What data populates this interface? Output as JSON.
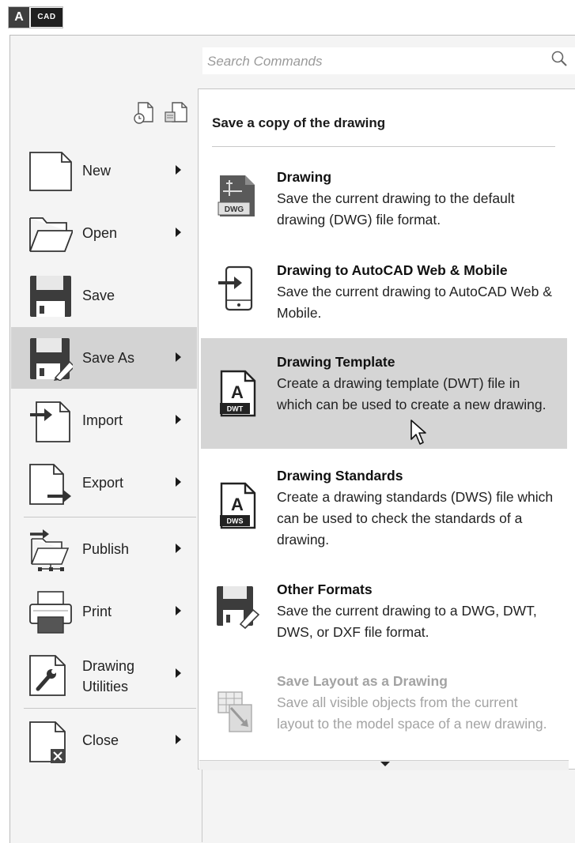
{
  "app_button": {
    "letter": "A",
    "tag": "CAD"
  },
  "search": {
    "placeholder": "Search Commands"
  },
  "left_menu": {
    "items": [
      {
        "label": "New",
        "has_submenu": true
      },
      {
        "label": "Open",
        "has_submenu": true
      },
      {
        "label": "Save",
        "has_submenu": false
      },
      {
        "label": "Save As",
        "has_submenu": true,
        "active": true
      },
      {
        "label": "Import",
        "has_submenu": true
      },
      {
        "label": "Export",
        "has_submenu": true
      },
      {
        "label": "Publish",
        "has_submenu": true
      },
      {
        "label": "Print",
        "has_submenu": true
      },
      {
        "label": "Drawing\nUtilities",
        "has_submenu": true
      },
      {
        "label": "Close",
        "has_submenu": true
      }
    ]
  },
  "submenu": {
    "title": "Save a copy of the drawing",
    "items": [
      {
        "title": "Drawing",
        "description": "Save the current drawing to the default drawing (DWG) file format.",
        "badge": "DWG"
      },
      {
        "title": "Drawing to AutoCAD Web & Mobile",
        "description": "Save the current drawing to AutoCAD Web & Mobile."
      },
      {
        "title": "Drawing Template",
        "description": "Create a drawing template (DWT) file in which can be used to create a new drawing.",
        "badge": "DWT",
        "badge_letter": "A",
        "active": true
      },
      {
        "title": "Drawing Standards",
        "description": "Create a drawing standards (DWS) file which can be used to check the standards of a drawing.",
        "badge": "DWS",
        "badge_letter": "A"
      },
      {
        "title": "Other Formats",
        "description": "Save the current drawing to a DWG, DWT, DWS, or DXF file format."
      },
      {
        "title": "Save Layout as a Drawing",
        "description": "Save all visible objects from the current layout to the model space of a new drawing.",
        "disabled": true
      }
    ]
  },
  "colors": {
    "active_bg": "#d3d3d3",
    "disabled_text": "#a3a3a3",
    "icon_dark": "#3c3c3c"
  }
}
